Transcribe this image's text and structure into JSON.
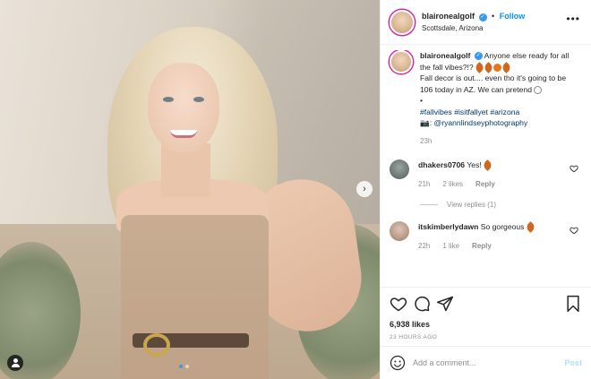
{
  "post": {
    "username": "blaironealgolf",
    "follow_label": "Follow",
    "separator": "•",
    "location": "Scottsdale, Arizona",
    "more_label": "•••",
    "caption": {
      "line1": "Anyone else ready for all the fall vibes?!?",
      "line2": "Fall decor is out.... even tho it's going to be 106 today in AZ. We can pretend",
      "bullet": "•",
      "hashtags": "#fallvibes #isitfallyet #arizona",
      "camera": "📷: ",
      "photo_credit": "@ryannlindseyphotography",
      "time": "23h"
    },
    "comments": [
      {
        "username": "dhakers0706",
        "text": "Yes!",
        "time": "21h",
        "likes": "2 likes",
        "reply_label": "Reply",
        "view_replies": "View replies (1)"
      },
      {
        "username": "itskimberlydawn",
        "text": "So gorgeous",
        "time": "22h",
        "likes": "1 like",
        "reply_label": "Reply"
      }
    ],
    "likes_count": "6,938 likes",
    "date": "23 HOURS AGO",
    "add_comment_placeholder": "Add a comment...",
    "post_label": "Post"
  },
  "carousel": {
    "slide_count": 2,
    "active_index": 0
  },
  "icons": {
    "heart": "heart-icon",
    "comment": "comment-icon",
    "share": "share-icon",
    "bookmark": "bookmark-icon",
    "next": "chevron-right-icon",
    "tag": "user-tag-icon",
    "emoji": "smile-icon"
  },
  "colors": {
    "accent": "#0095f6",
    "verified": "#3897f0",
    "muted": "#8e8e8e",
    "post_disabled": "#b2dffc",
    "text": "#262626"
  }
}
